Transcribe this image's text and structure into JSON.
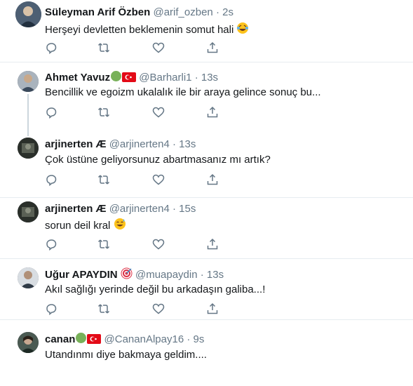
{
  "tweets": [
    {
      "name": "Süleyman Arif Özben",
      "handle": "@arif_ozben",
      "time": "2s",
      "text": "Herşeyi devletten beklemenin somut hali",
      "text_emoji": "laugh-cry-emoji",
      "name_badges": []
    },
    {
      "name": "Ahmet Yavuz",
      "handle": "@Barharli1",
      "time": "13s",
      "text": "Bencillik ve egoizm ukalalık ile bir araya gelince sonuç bu...",
      "name_badges": [
        "green-circle",
        "turkey-flag"
      ]
    },
    {
      "name": "arjinerten Æ",
      "handle": "@arjinerten4",
      "time": "13s",
      "text": "Çok üstüne geliyorsunuz abartmasanız mı artık?",
      "name_badges": []
    },
    {
      "name": "arjinerten Æ",
      "handle": "@arjinerten4",
      "time": "15s",
      "text": "sorun deil kral",
      "text_emoji": "sweat-smile-emoji",
      "name_badges": []
    },
    {
      "name": "Uğur APAYDIN",
      "handle": "@muapaydin",
      "time": "13s",
      "text": "Akıl sağlığı yerinde değil bu arkadaşın galiba...!",
      "name_badges": [
        "target-emoji"
      ]
    },
    {
      "name": "canan",
      "handle": "@CananAlpay16",
      "time": "9s",
      "text": "Utandınmı diye bakmaya geldim....",
      "name_badges": [
        "green-circle",
        "turkey-flag"
      ]
    }
  ],
  "separator": "·",
  "icons": [
    "reply-icon",
    "retweet-icon",
    "like-icon",
    "share-icon"
  ],
  "colors": {
    "icon": "#657786",
    "text": "#14171a",
    "secondary": "#657786",
    "divider": "#e6ecf0",
    "thread": "#ccd6dd"
  }
}
